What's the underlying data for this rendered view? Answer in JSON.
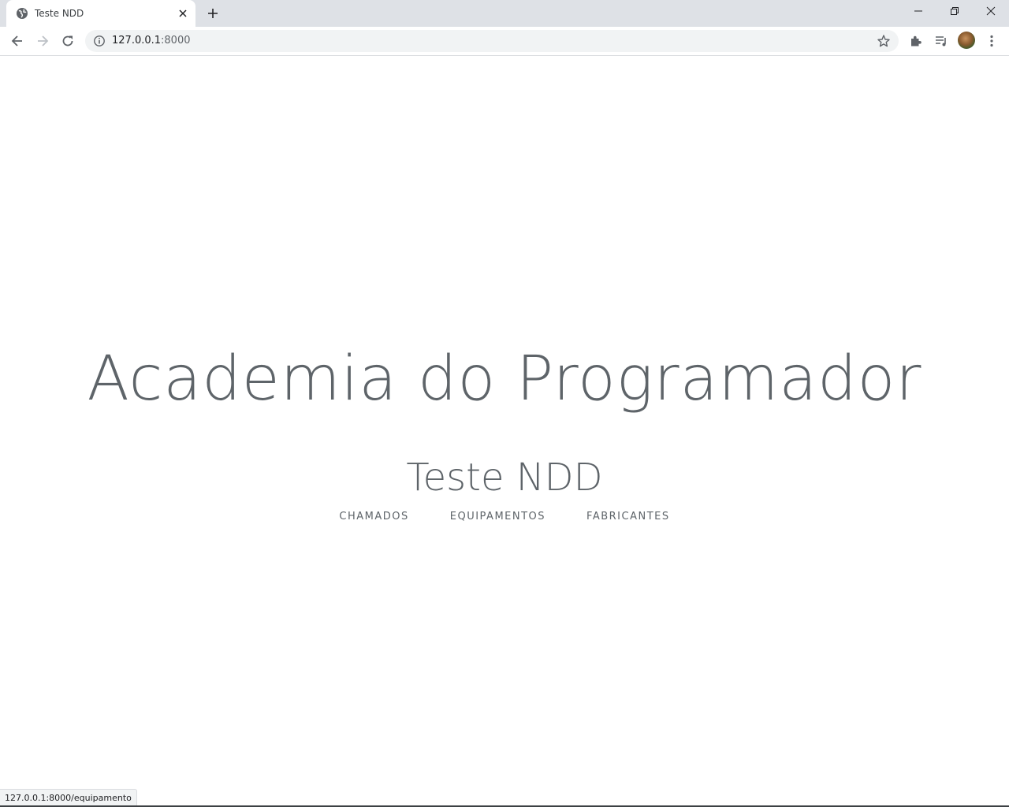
{
  "browser": {
    "tab": {
      "title": "Teste NDD",
      "favicon": "globe-icon",
      "close_icon": "close-icon"
    },
    "new_tab_icon": "plus-icon",
    "window_controls": [
      "minimize-icon",
      "restore-icon",
      "close-icon"
    ],
    "toolbar": {
      "back_icon": "arrow-left-icon",
      "forward_icon": "arrow-right-icon",
      "reload_icon": "reload-icon",
      "site_info_icon": "info-icon",
      "url_host": "127.0.0.1",
      "url_port": ":8000",
      "bookmark_icon": "star-icon",
      "extensions_icon": "puzzle-icon",
      "media_icon": "playlist-icon",
      "menu_icon": "kebab-menu-icon"
    },
    "status_url": "127.0.0.1:8000/equipamento"
  },
  "page": {
    "masthead_title": "Academia do Programador",
    "subtitle": "Teste NDD",
    "nav": [
      {
        "label": "CHAMADOS"
      },
      {
        "label": "EQUIPAMENTOS"
      },
      {
        "label": "FABRICANTES"
      }
    ],
    "text_color": "#5e6469"
  }
}
